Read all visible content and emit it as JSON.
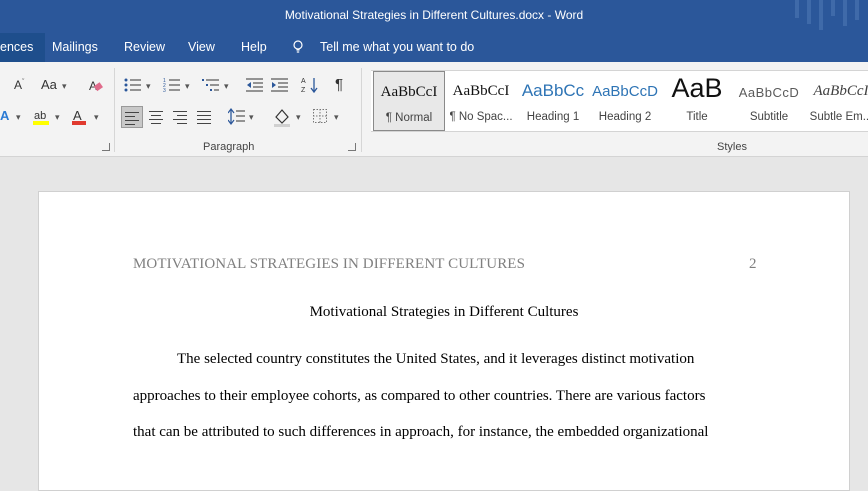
{
  "window": {
    "title": "Motivational Strategies in Different Cultures.docx  -  Word"
  },
  "menu": {
    "tabs": [
      "ences",
      "Mailings",
      "Review",
      "View",
      "Help"
    ],
    "tell_me": "Tell me what you want to do"
  },
  "ribbon": {
    "font_group": {
      "change_case": "Aa",
      "shrink": "A",
      "font_color": "A"
    },
    "paragraph_label": "Paragraph",
    "styles_label": "Styles",
    "styles": [
      {
        "preview": "AaBbCcI",
        "name": "¶ Normal"
      },
      {
        "preview": "AaBbCcI",
        "name": "¶ No Spac..."
      },
      {
        "preview": "AaBbCc",
        "name": "Heading 1"
      },
      {
        "preview": "AaBbCcD",
        "name": "Heading 2"
      },
      {
        "preview": "AaB",
        "name": "Title"
      },
      {
        "preview": "AaBbCcD",
        "name": "Subtitle"
      },
      {
        "preview": "AaBbCcI",
        "name": "Subtle Em..."
      }
    ]
  },
  "document": {
    "running_header": "MOTIVATIONAL STRATEGIES IN DIFFERENT CULTURES",
    "page_number": "2",
    "title": "Motivational Strategies in Different Cultures",
    "lines": [
      "The selected country constitutes the United States, and it leverages distinct motivation",
      "approaches to their employee cohorts, as compared to other countries. There are various factors",
      "that can be attributed to such differences in approach, for instance, the embedded organizational"
    ]
  },
  "colors": {
    "word_blue": "#2b579a",
    "ribbon_bg": "#f3f3f3",
    "page_bg": "#ffffff",
    "canvas_bg": "#e6e6e6",
    "header_gray": "#7f7f7f",
    "highlight_yellow": "#ffff00",
    "font_red": "#e03a2f"
  }
}
